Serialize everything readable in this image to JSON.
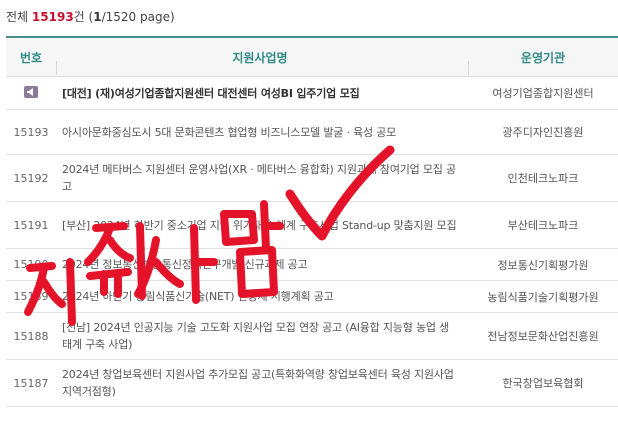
{
  "summary": {
    "prefix": "전체",
    "count": "15193",
    "unit": "건",
    "paren_open": "(",
    "current_page": "1",
    "page_rest": "/1520 page)"
  },
  "table": {
    "headers": {
      "number": "번호",
      "title": "지원사업명",
      "org": "운영기관"
    },
    "rows": [
      {
        "number": "",
        "notice": true,
        "title": "[대전] (재)여성기업종합지원센터 대전센터 여성BI 입주기업 모집",
        "org": "여성기업종합지원센터"
      },
      {
        "number": "15193",
        "title": "아시아문화중심도시 5대 문화콘텐츠 협업형 비즈니스모델 발굴 · 육성 공모",
        "org": "광주디자인진흥원"
      },
      {
        "number": "15192",
        "title": "2024년 메타버스 지원센터 운영사업(XR · 메타버스 융합화) 지원과제 참여기업 모집 공고",
        "org": "인천테크노파크"
      },
      {
        "number": "15191",
        "title": "[부산] 2024년 하반기 중소기업 지역 위기대응 체계 구축사업 Stand-up 맞춤지원 모집",
        "org": "부산테크노파크"
      },
      {
        "number": "15190",
        "title": "2024년 정보통신방송통신정책연구개발 신규과제 공고",
        "org": "정보통신기획평가원"
      },
      {
        "number": "15189",
        "title": "2024년 하반기 농림식품신기술(NET) 인증제 시행계획 공고",
        "org": "농림식품기술기획평가원"
      },
      {
        "number": "15188",
        "title": "[전남] 2024년 인공지능 기술 고도화 지원사업 모집 연장 공고 (AI융합 지능형 농업 생태계 구축 사업)",
        "org": "전남정보문화산업진흥원"
      },
      {
        "number": "15187",
        "title": "2024년 창업보육센터 지원사업 추가모집 공고(특화화역량 창업보육센터 육성 지원사업 지역거점형)",
        "org": "한국창업보육협회"
      }
    ]
  },
  "annotation": {
    "handwritten_text": "지원사업",
    "color": "#e5132a"
  },
  "colors": {
    "header_accent": "#2f8a85",
    "count_red": "#c8102e"
  }
}
